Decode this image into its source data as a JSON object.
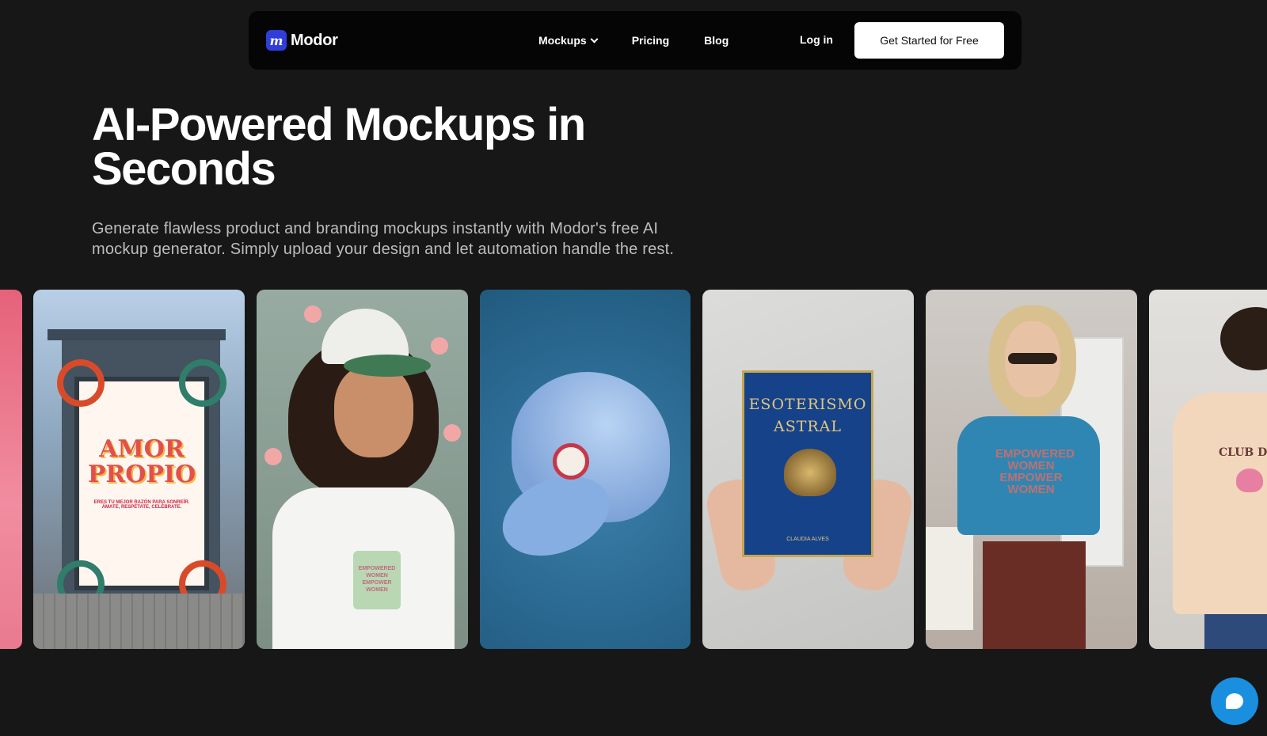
{
  "brand": {
    "logo_mark": "m",
    "name": "Modor",
    "accent": "#2f3dd9"
  },
  "nav": {
    "items": [
      {
        "label": "Mockups",
        "has_dropdown": true
      },
      {
        "label": "Pricing"
      },
      {
        "label": "Blog"
      }
    ],
    "login_label": "Log in",
    "cta_label": "Get Started for Free"
  },
  "hero": {
    "title_line1": "AI-Powered Mockups in",
    "title_line2": "Seconds",
    "subtitle_line1": "Generate flawless product and branding mockups instantly with Modor's free AI",
    "subtitle_line2": "mockup generator. Simply upload your design and let automation handle the rest."
  },
  "gallery": {
    "cards": [
      {
        "subject": "partial-pink-mockup"
      },
      {
        "subject": "bus-shelter-poster",
        "poster_line1": "AMOR",
        "poster_line2": "PROPIO",
        "poster_small": "ERES TU MEJOR RAZÓN PARA SONREÍR. ÁMATE, RESPÉTATE, CELÉBRATE."
      },
      {
        "subject": "woman-cap-mug",
        "mug_text": "EMPOWERED WOMEN EMPOWER WOMEN"
      },
      {
        "subject": "blue-cap"
      },
      {
        "subject": "book-cover",
        "book_title1": "ESOTERISMO",
        "book_title2": "ASTRAL",
        "book_author": "CLAUDIA ALVES"
      },
      {
        "subject": "woman-blue-tshirt",
        "tee_line1": "EMPOWERED",
        "tee_line2": "WOMEN",
        "tee_line3": "EMPOWER",
        "tee_line4": "WOMEN"
      },
      {
        "subject": "man-sweater",
        "sweater_text": "CLUB D"
      }
    ]
  },
  "chat": {
    "icon": "chat-bubble-icon",
    "color": "#1a8fe0"
  }
}
